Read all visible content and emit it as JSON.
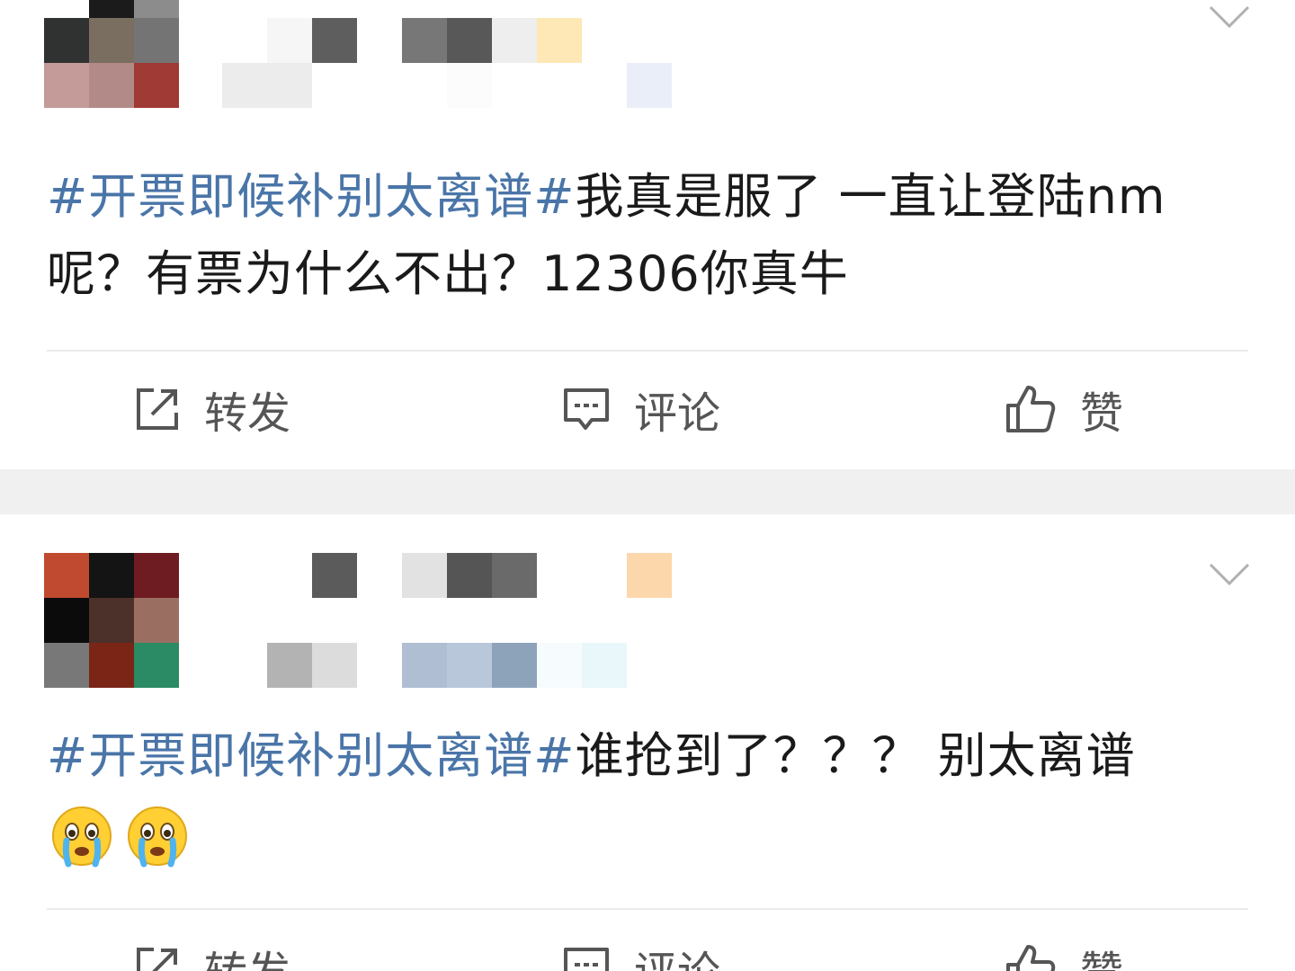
{
  "posts": [
    {
      "avatar_pixels": [
        "#ffffff",
        "#1b1b1b",
        "#8c8c8c",
        "#2f3230",
        "#7a6e61",
        "#747474",
        "#c49b99",
        "#b28a88",
        "#a03a35"
      ],
      "name_pixels": [
        "#ffffff",
        "#f6f6f6",
        "#5e5e5e",
        "#ffffff",
        "#777777",
        "#585858",
        "#eeeeee",
        "#fde8b6",
        "#ffffff",
        "#ffffff",
        "#ececec",
        "#ececec",
        "#ffffff",
        "#ffffff",
        "#ffffff",
        "#fcfcfc",
        "#ffffff",
        "#ffffff",
        "#ffffff",
        "#e9eef8"
      ],
      "topic": "#开票即候补别太离谱#",
      "text": "我真是服了 一直让登陆nm呢？有票为什么不出？12306你真牛",
      "emojis": []
    },
    {
      "avatar_pixels": [
        "#c04a2f",
        "#141414",
        "#6e1c22",
        "#0b0b0b",
        "#4b3129",
        "#9b6e62",
        "#787878",
        "#7b2517",
        "#2a8b64"
      ],
      "name_pixels": [
        "#ffffff",
        "#ffffff",
        "#5b5b5b",
        "#ffffff",
        "#e2e2e2",
        "#555555",
        "#6a6a6a",
        "#ffffff",
        "#ffffff",
        "#fdd7ac",
        "#ffffff",
        "#ffffff",
        "#ffffff",
        "#ffffff",
        "#ffffff",
        "#ffffff",
        "#ffffff",
        "#ffffff",
        "#ffffff",
        "#ffffff",
        "#ffffff",
        "#b3b3b3",
        "#dcdcdc",
        "#ffffff",
        "#afbed2",
        "#b9c7da",
        "#8da3ba",
        "#f6fbfe",
        "#eaf7fa",
        "#ffffff"
      ],
      "topic": "#开票即候补别太离谱#",
      "text": "谁抢到了？？？ 别太离谱",
      "emojis": [
        "crying-face-emoji",
        "crying-face-emoji"
      ]
    }
  ],
  "actions": {
    "repost_label": "转发",
    "comment_label": "评论",
    "like_label": "赞"
  },
  "colors": {
    "topic": "#4a75a8",
    "text": "#1a1a1a",
    "action": "#555555",
    "separator": "#f0f0f0"
  }
}
